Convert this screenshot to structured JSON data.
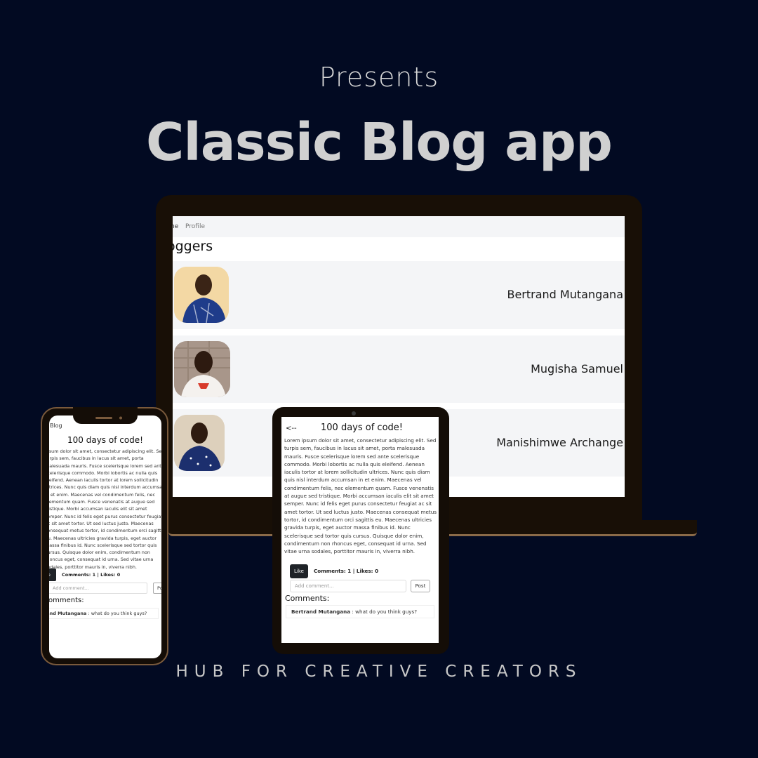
{
  "promo": {
    "presents": "Presents",
    "headline": "Classic Blog app",
    "tagline": "HUB FOR CREATIVE CREATORS"
  },
  "laptop": {
    "nav": {
      "home": "me",
      "profile": "Profile"
    },
    "page_title": "oggers",
    "users": [
      {
        "name": "Bertrand Mutangana"
      },
      {
        "name": "Mugisha Samuel"
      },
      {
        "name": "Manishimwe Archange"
      }
    ]
  },
  "phone": {
    "brand": "c Blog",
    "post_title": "100 days of code!",
    "body": "ipsum dolor sit amet, consectetur adipiscing elit. Sed turpis sem, faucibus in lacus sit amet, porta malesuada mauris. Fusce scelerisque lorem sed ante scelerisque commodo. Morbi lobortis ac nulla quis eleifend. Aenean iaculis tortor at lorem sollicitudin ultrices. Nunc quis diam quis nisl interdum accumsan in et enim. Maecenas vel condimentum felis, nec elementum quam. Fusce venenatis at augue sed tristique. Morbi accumsan iaculis elit sit amet semper. Nunc id felis eget purus consectetur feugiat ac sit amet tortor. Ut sed luctus justo. Maecenas consequat metus tortor, id condimentum orci sagittis eu. Maecenas ultricies gravida turpis, eget auctor massa finibus id. Nunc scelerisque sed tortor quis cursus. Quisque dolor enim, condimentum non rhoncus eget, consequat id urna. Sed vitae urna sodales, porttitor mauris in, viverra nibh.",
    "like_label": "e",
    "stats": "Comments: 1 | Likes: 0",
    "comment_placeholder": "Add comment...",
    "post_label": "Po",
    "comments_heading": "Comments:",
    "comment_author": "rand Mutangana",
    "comment_text": " : what do you think guys?"
  },
  "tablet": {
    "back": "<--",
    "post_title": "100 days of code!",
    "body": "Lorem ipsum dolor sit amet, consectetur adipiscing elit. Sed turpis sem, faucibus in lacus sit amet, porta malesuada mauris. Fusce scelerisque lorem sed ante scelerisque commodo. Morbi lobortis ac nulla quis eleifend. Aenean iaculis tortor at lorem sollicitudin ultrices. Nunc quis diam quis nisl interdum accumsan in et enim. Maecenas vel condimentum felis, nec elementum quam. Fusce venenatis at augue sed tristique. Morbi accumsan iaculis elit sit amet semper. Nunc id felis eget purus consectetur feugiat ac sit amet tortor. Ut sed luctus justo. Maecenas consequat metus tortor, id condimentum orci sagittis eu. Maecenas ultricies gravida turpis, eget auctor massa finibus id. Nunc scelerisque sed tortor quis cursus. Quisque dolor enim, condimentum non rhoncus eget, consequat id urna. Sed vitae urna sodales, porttitor mauris in, viverra nibh.",
    "like_label": "Like",
    "stats": "Comments: 1 | Likes: 0",
    "comment_placeholder": "Add comment...",
    "post_label": "Post",
    "comments_heading": "Comments:",
    "comment_author": "Bertrand Mutangana",
    "comment_text": " : what do you think guys?"
  },
  "colors": {
    "background": "#020a22",
    "device_frame": "#180f06",
    "like_button": "#1f2328"
  }
}
